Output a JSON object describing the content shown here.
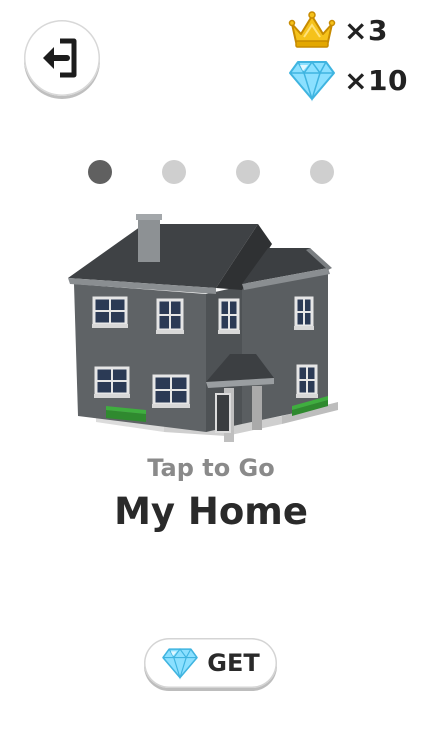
{
  "header": {
    "back_icon": "exit-door-icon",
    "currencies": [
      {
        "icon": "crown-icon",
        "label": "×3",
        "color": "#f2b705"
      },
      {
        "icon": "diamond-icon",
        "label": "×10",
        "color": "#7fd8ff"
      }
    ]
  },
  "pager": {
    "count": 4,
    "active_index": 0
  },
  "level": {
    "subtitle": "Tap to Go",
    "title": "My Home"
  },
  "get_button": {
    "icon": "diamond-icon",
    "label": "GET"
  }
}
